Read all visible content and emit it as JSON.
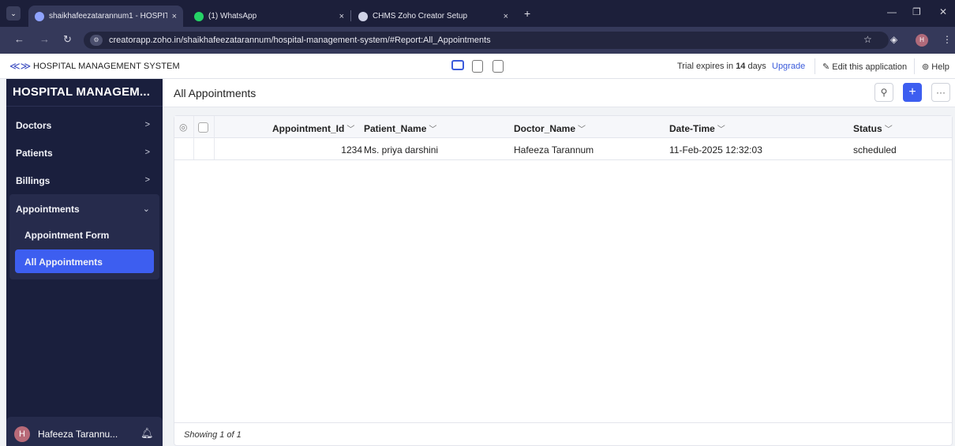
{
  "browser": {
    "tabs": [
      {
        "title": "shaikhafeezatarannum1 - HOSPITA",
        "close": "×"
      },
      {
        "title": "(1) WhatsApp",
        "close": "×"
      },
      {
        "title": "CHMS Zoho Creator Setup",
        "close": "×"
      }
    ],
    "new_tab": "+",
    "url": "creatorapp.zoho.in/shaikhafeezatarannum/hospital-management-system/#Report:All_Appointments",
    "profile_initial": "H"
  },
  "app_header": {
    "app_name": "HOSPITAL MANAGEMENT SYSTEM",
    "trial_prefix": "Trial expires in",
    "trial_days": "14",
    "trial_suffix": "days",
    "upgrade": "Upgrade",
    "edit_app": "Edit this application",
    "help": "Help"
  },
  "sidebar": {
    "title": "HOSPITAL MANAGEM...",
    "items": [
      {
        "label": "Doctors"
      },
      {
        "label": "Patients"
      },
      {
        "label": "Billings"
      },
      {
        "label": "Appointments"
      }
    ],
    "sub_items": [
      {
        "label": "Appointment Form"
      },
      {
        "label": "All Appointments"
      }
    ],
    "user": {
      "initial": "H",
      "name": "Hafeeza Tarannu..."
    }
  },
  "main": {
    "title": "All Appointments",
    "columns": [
      "Appointment_Id",
      "Patient_Name",
      "Doctor_Name",
      "Date-Time",
      "Status"
    ],
    "rows": [
      {
        "appointment_id": "1234",
        "patient_name": "Ms. priya darshini",
        "doctor_name": "Hafeeza Tarannum",
        "date_time": "11-Feb-2025 12:32:03",
        "status": "scheduled"
      }
    ],
    "footer": "Showing 1 of 1"
  },
  "colors": {
    "sidebar_bg": "#1a1f3d",
    "accent": "#3d5ef0",
    "tabbar_bg": "#1c1f3a"
  }
}
